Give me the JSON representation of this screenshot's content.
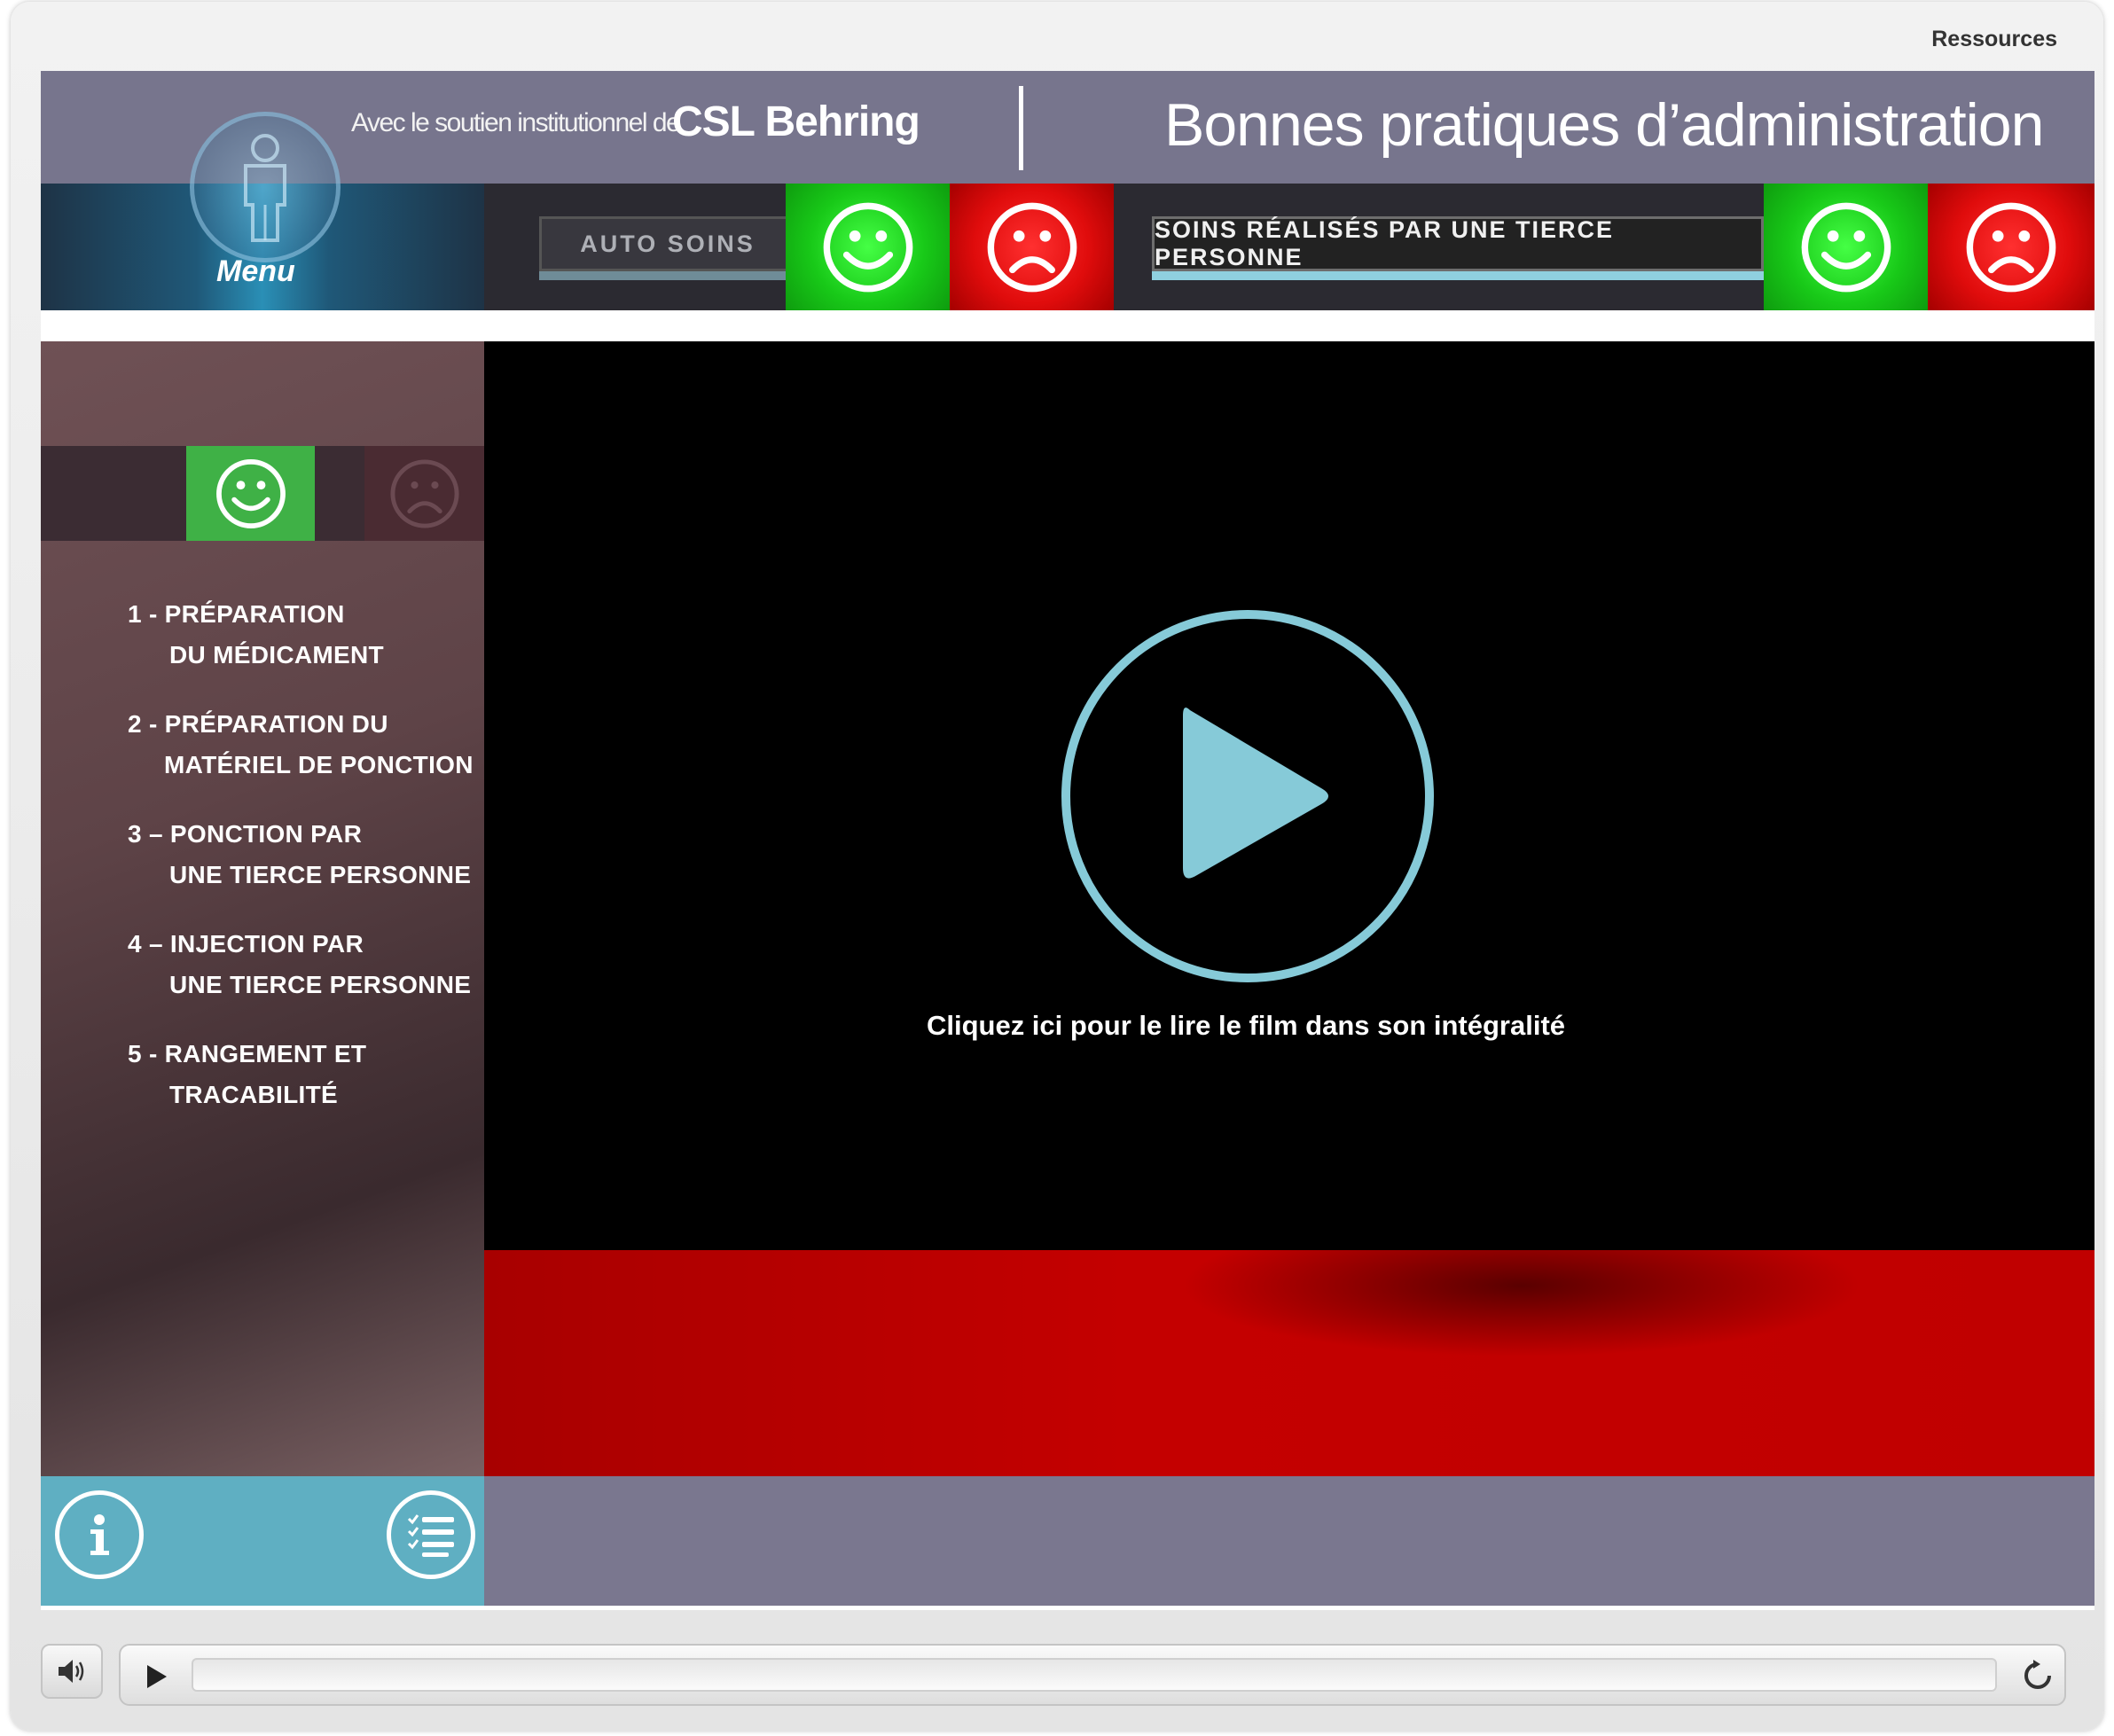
{
  "window": {
    "resources_link": "Ressources"
  },
  "header": {
    "sponsor_text": "Avec le soutien institutionnel de",
    "brand": "CSL Behring",
    "title": "Bonnes pratiques d’administration"
  },
  "toolbar": {
    "menu_label": "Menu",
    "auto_soins_label": "AUTO SOINS",
    "tierce_label": "SOINS RÉALISÉS PAR UNE TIERCE PERSONNE"
  },
  "sidebar": {
    "steps": [
      {
        "line1": "1 - PRÉPARATION",
        "line2": "DU MÉDICAMENT"
      },
      {
        "line1": "2 - PRÉPARATION DU",
        "line2": "MATÉRIEL DE PONCTION"
      },
      {
        "line1": "3 – PONCTION PAR",
        "line2": "UNE TIERCE PERSONNE"
      },
      {
        "line1": "4 – INJECTION PAR",
        "line2": "UNE TIERCE PERSONNE"
      },
      {
        "line1": "5 - RANGEMENT ET",
        "line2": "TRACABILITÉ"
      }
    ]
  },
  "video": {
    "caption": "Cliquez ici pour le lire le film dans son intégralité"
  },
  "colors": {
    "accent_teal": "#86cad8",
    "good_green": "#18c918",
    "bad_red": "#e00c0c",
    "header_gray": "#77758d"
  },
  "icons": [
    "avatar-icon",
    "smiley-happy-icon",
    "smiley-sad-icon",
    "play-circle-icon",
    "info-icon",
    "checklist-icon",
    "speaker-icon",
    "play-icon",
    "replay-icon"
  ]
}
